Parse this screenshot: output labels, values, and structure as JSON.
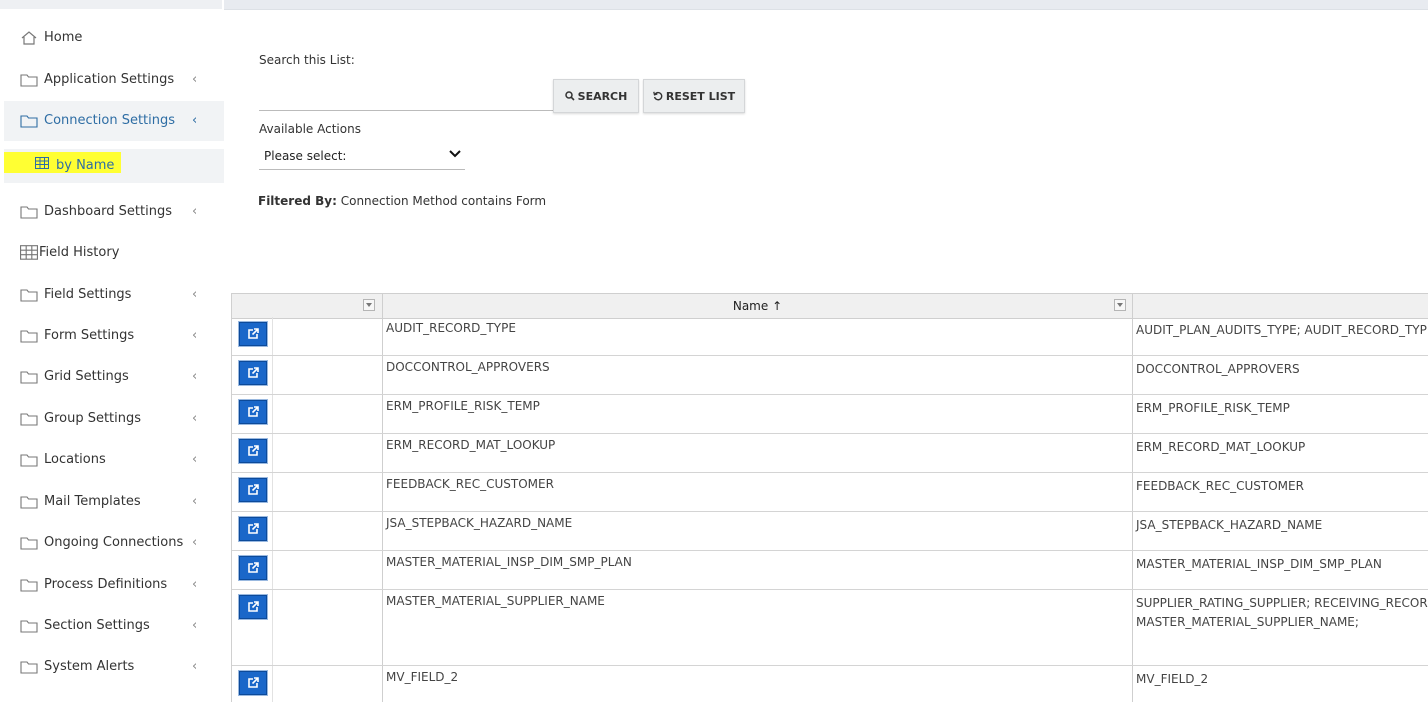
{
  "sidebar": {
    "items": [
      {
        "label": "Home",
        "icon": "home-icon",
        "chevron": ""
      },
      {
        "label": "Application Settings",
        "icon": "folder-icon",
        "chevron": "‹"
      },
      {
        "label": "Connection Settings",
        "icon": "folder-icon",
        "chevron": "‹"
      },
      {
        "label": "Dashboard Settings",
        "icon": "folder-icon",
        "chevron": "‹"
      },
      {
        "label": "Field History",
        "icon": "table-icon",
        "chevron": ""
      },
      {
        "label": "Field Settings",
        "icon": "folder-icon",
        "chevron": "‹"
      },
      {
        "label": "Form Settings",
        "icon": "folder-icon",
        "chevron": "‹"
      },
      {
        "label": "Grid Settings",
        "icon": "folder-icon",
        "chevron": "‹"
      },
      {
        "label": "Group Settings",
        "icon": "folder-icon",
        "chevron": "‹"
      },
      {
        "label": "Locations",
        "icon": "folder-icon",
        "chevron": "‹"
      },
      {
        "label": "Mail Templates",
        "icon": "folder-icon",
        "chevron": "‹"
      },
      {
        "label": "Ongoing Connections",
        "icon": "folder-icon",
        "chevron": "‹"
      },
      {
        "label": "Process Definitions",
        "icon": "folder-icon",
        "chevron": "‹"
      },
      {
        "label": "Section Settings",
        "icon": "folder-icon",
        "chevron": "‹"
      },
      {
        "label": "System Alerts",
        "icon": "folder-icon",
        "chevron": "‹"
      }
    ],
    "sub_item": {
      "label": "by Name",
      "icon": "table-icon",
      "highlight_color": "#ffff33"
    },
    "active_color": "#2e6da4"
  },
  "search": {
    "label": "Search this List:",
    "value": "",
    "search_button": "SEARCH",
    "reset_button": "RESET LIST"
  },
  "actions": {
    "label": "Available Actions",
    "selected": "Please select:"
  },
  "filter": {
    "prefix": "Filtered By:",
    "text": "Connection Method contains Form"
  },
  "grid": {
    "columns": [
      "",
      "Name",
      ""
    ],
    "sort_indicator": "↑",
    "edit_button_color": "#1a67c9",
    "rows": [
      {
        "name": "AUDIT_RECORD_TYPE",
        "forms": "AUDIT_PLAN_AUDITS_TYPE; AUDIT_RECORD_TYPE"
      },
      {
        "name": "DOCCONTROL_APPROVERS",
        "forms": "DOCCONTROL_APPROVERS"
      },
      {
        "name": "ERM_PROFILE_RISK_TEMP",
        "forms": "ERM_PROFILE_RISK_TEMP"
      },
      {
        "name": "ERM_RECORD_MAT_LOOKUP",
        "forms": "ERM_RECORD_MAT_LOOKUP"
      },
      {
        "name": "FEEDBACK_REC_CUSTOMER",
        "forms": "FEEDBACK_REC_CUSTOMER"
      },
      {
        "name": "JSA_STEPBACK_HAZARD_NAME",
        "forms": "JSA_STEPBACK_HAZARD_NAME"
      },
      {
        "name": "MASTER_MATERIAL_INSP_DIM_SMP_PLAN",
        "forms": "MASTER_MATERIAL_INSP_DIM_SMP_PLAN"
      },
      {
        "name": "MASTER_MATERIAL_SUPPLIER_NAME",
        "forms": "SUPPLIER_RATING_SUPPLIER; RECEIVING_RECORD\nMASTER_MATERIAL_SUPPLIER_NAME;"
      },
      {
        "name": "MV_FIELD_2",
        "forms": "MV_FIELD_2"
      }
    ]
  }
}
